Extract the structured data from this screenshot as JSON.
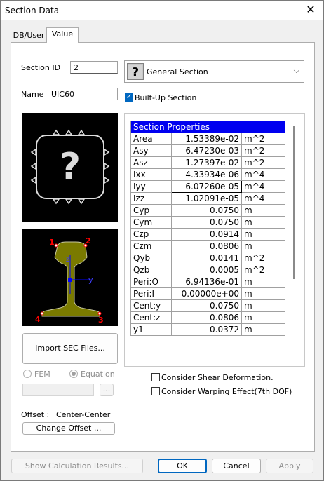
{
  "window": {
    "title": "Section Data"
  },
  "tabs": [
    {
      "label": "DB/User"
    },
    {
      "label": "Value"
    }
  ],
  "section_id": {
    "label": "Section ID",
    "value": "2"
  },
  "section_type": {
    "value": "General Section"
  },
  "name": {
    "label": "Name",
    "value": "UIC60"
  },
  "builtup": {
    "label": "Built-Up Section",
    "checked": true
  },
  "shape_points": [
    "1",
    "2",
    "3",
    "4"
  ],
  "axes": {
    "z": "z",
    "y": "y"
  },
  "import_button": {
    "label": "Import SEC Files..."
  },
  "method": {
    "fem_label": "FEM",
    "equation_label": "Equation",
    "selected": "Equation"
  },
  "browse_button": {
    "label": "..."
  },
  "offset": {
    "label": "Offset :",
    "value": "Center-Center",
    "button_label": "Change Offset ..."
  },
  "properties": {
    "header": "Section Properties",
    "rows": [
      {
        "name": "Area",
        "value": "1.53389e-02",
        "unit": "m^2"
      },
      {
        "name": "Asy",
        "value": "6.47230e-03",
        "unit": "m^2"
      },
      {
        "name": "Asz",
        "value": "1.27397e-02",
        "unit": "m^2"
      },
      {
        "name": "Ixx",
        "value": "4.33934e-06",
        "unit": "m^4"
      },
      {
        "name": "Iyy",
        "value": "6.07260e-05",
        "unit": "m^4"
      },
      {
        "name": "Izz",
        "value": "1.02091e-05",
        "unit": "m^4"
      },
      {
        "name": "Cyp",
        "value": "0.0750",
        "unit": "m"
      },
      {
        "name": "Cym",
        "value": "0.0750",
        "unit": "m"
      },
      {
        "name": "Czp",
        "value": "0.0914",
        "unit": "m"
      },
      {
        "name": "Czm",
        "value": "0.0806",
        "unit": "m"
      },
      {
        "name": "Qyb",
        "value": "0.0141",
        "unit": "m^2"
      },
      {
        "name": "Qzb",
        "value": "0.0005",
        "unit": "m^2"
      },
      {
        "name": "Peri:O",
        "value": "6.94136e-01",
        "unit": "m"
      },
      {
        "name": "Peri:I",
        "value": "0.00000e+00",
        "unit": "m"
      },
      {
        "name": "Cent:y",
        "value": "0.0750",
        "unit": "m"
      },
      {
        "name": "Cent:z",
        "value": "0.0806",
        "unit": "m"
      },
      {
        "name": "y1",
        "value": "-0.0372",
        "unit": "m"
      }
    ]
  },
  "options": {
    "shear_label": "Consider Shear Deformation.",
    "warping_label": "Consider Warping Effect(7th DOF)"
  },
  "footer": {
    "show_results": "Show Calculation Results...",
    "ok": "OK",
    "cancel": "Cancel",
    "apply": "Apply"
  },
  "colors": {
    "rail_fill": "#7a7a00",
    "accent": "#0067c0",
    "grid_header": "#0000f0"
  }
}
